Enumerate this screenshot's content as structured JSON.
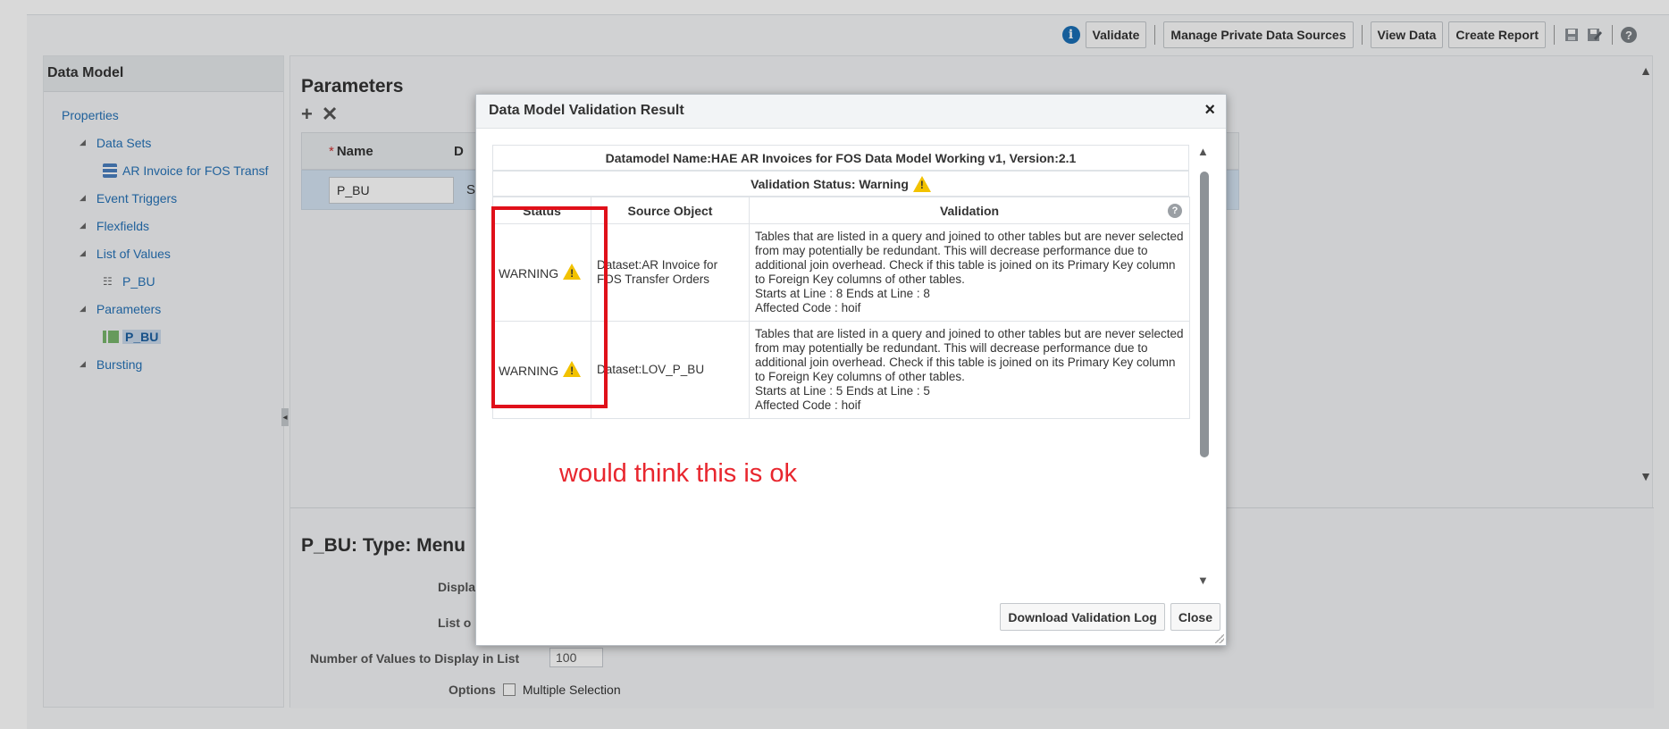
{
  "toolbar": {
    "validate_label": "Validate",
    "manage_sources_label": "Manage Private Data Sources",
    "view_data_label": "View Data",
    "create_report_label": "Create Report",
    "info_icon": "i",
    "save_icon": "save-icon",
    "save_as_icon": "save-as-icon",
    "help_icon": "?"
  },
  "left_panel": {
    "title": "Data Model",
    "items": [
      {
        "label": "Properties"
      },
      {
        "label": "Data Sets"
      },
      {
        "label": "AR Invoice for FOS Transf"
      },
      {
        "label": "Event Triggers"
      },
      {
        "label": "Flexfields"
      },
      {
        "label": "List of Values"
      },
      {
        "label": "P_BU"
      },
      {
        "label": "Parameters"
      },
      {
        "label": "P_BU"
      },
      {
        "label": "Bursting"
      }
    ]
  },
  "main": {
    "title": "Parameters",
    "add_icon": "+",
    "delete_icon": "✕",
    "table": {
      "required_mark": "*",
      "name_header": "Name",
      "col2_header": "D",
      "row_name": "P_BU",
      "row_col2": "S"
    },
    "detail": {
      "title": "P_BU: Type: Menu",
      "display_label": "Displa",
      "list_label": "List o",
      "num_values_label": "Number of Values to Display in List",
      "num_values_value": "100",
      "options_label": "Options",
      "multiple_selection_label": "Multiple Selection"
    }
  },
  "dialog": {
    "title": "Data Model Validation Result",
    "close_x": "×",
    "datamodel_line": "Datamodel Name:HAE AR Invoices for FOS Data Model Working v1, Version:2.1",
    "status_line": "Validation Status: Warning",
    "headers": {
      "status": "Status",
      "source": "Source Object",
      "validation": "Validation"
    },
    "rows": [
      {
        "status": "WARNING",
        "source": "Dataset:AR Invoice for FOS Transfer Orders",
        "validation_text": "Tables that are listed in a query and joined to other tables but are never selected from may potentially be redundant. This will decrease performance due to additional join overhead. Check if this table is joined on its Primary Key column to Foreign Key columns of other tables.",
        "lines": "Starts at Line : 8 Ends at Line : 8",
        "code": "Affected Code : hoif"
      },
      {
        "status": "WARNING",
        "source": "Dataset:LOV_P_BU",
        "validation_text": "Tables that are listed in a query and joined to other tables but are never selected from may potentially be redundant. This will decrease performance due to additional join overhead. Check if this table is joined on its Primary Key column to Foreign Key columns of other tables.",
        "lines": "Starts at Line : 5 Ends at Line : 5",
        "code": "Affected Code : hoif"
      }
    ],
    "download_label": "Download Validation Log",
    "close_label": "Close"
  },
  "annotation": {
    "text": "would think this is ok",
    "color": "#e8262e",
    "box_color": "#e0101a"
  },
  "colors": {
    "link": "#2672b7",
    "selected_row": "#d4e3f2",
    "warning": "#f2c200"
  }
}
